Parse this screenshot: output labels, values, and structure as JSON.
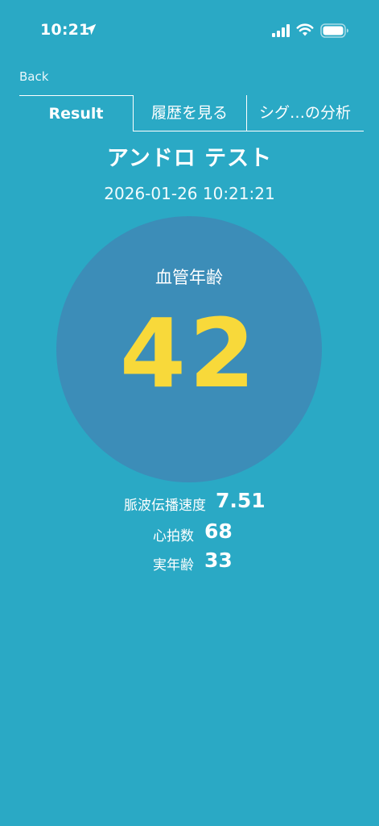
{
  "status_bar": {
    "time": "10:21",
    "icons": [
      "location-arrow-icon",
      "cellular-signal-icon",
      "wifi-icon",
      "battery-icon"
    ]
  },
  "nav": {
    "back_label": "Back"
  },
  "tabs": [
    {
      "label": "Result",
      "selected": true
    },
    {
      "label": "履歴を見る",
      "selected": false
    },
    {
      "label": "シグ…の分析",
      "selected": false
    }
  ],
  "result": {
    "title": "アンドロ テスト",
    "datetime": "2026-01-26 10:21:21",
    "vessel_age_label": "血管年齢",
    "vessel_age_value": "42",
    "metrics": [
      {
        "label": "脈波伝播速度",
        "value": "7.51"
      },
      {
        "label": "心拍数",
        "value": "68"
      },
      {
        "label": "実年齢",
        "value": "33"
      }
    ]
  },
  "colors": {
    "background": "#2aa9c5",
    "circle": "#3c8db8",
    "accent_value": "#f8d93a",
    "text": "#ffffff"
  }
}
